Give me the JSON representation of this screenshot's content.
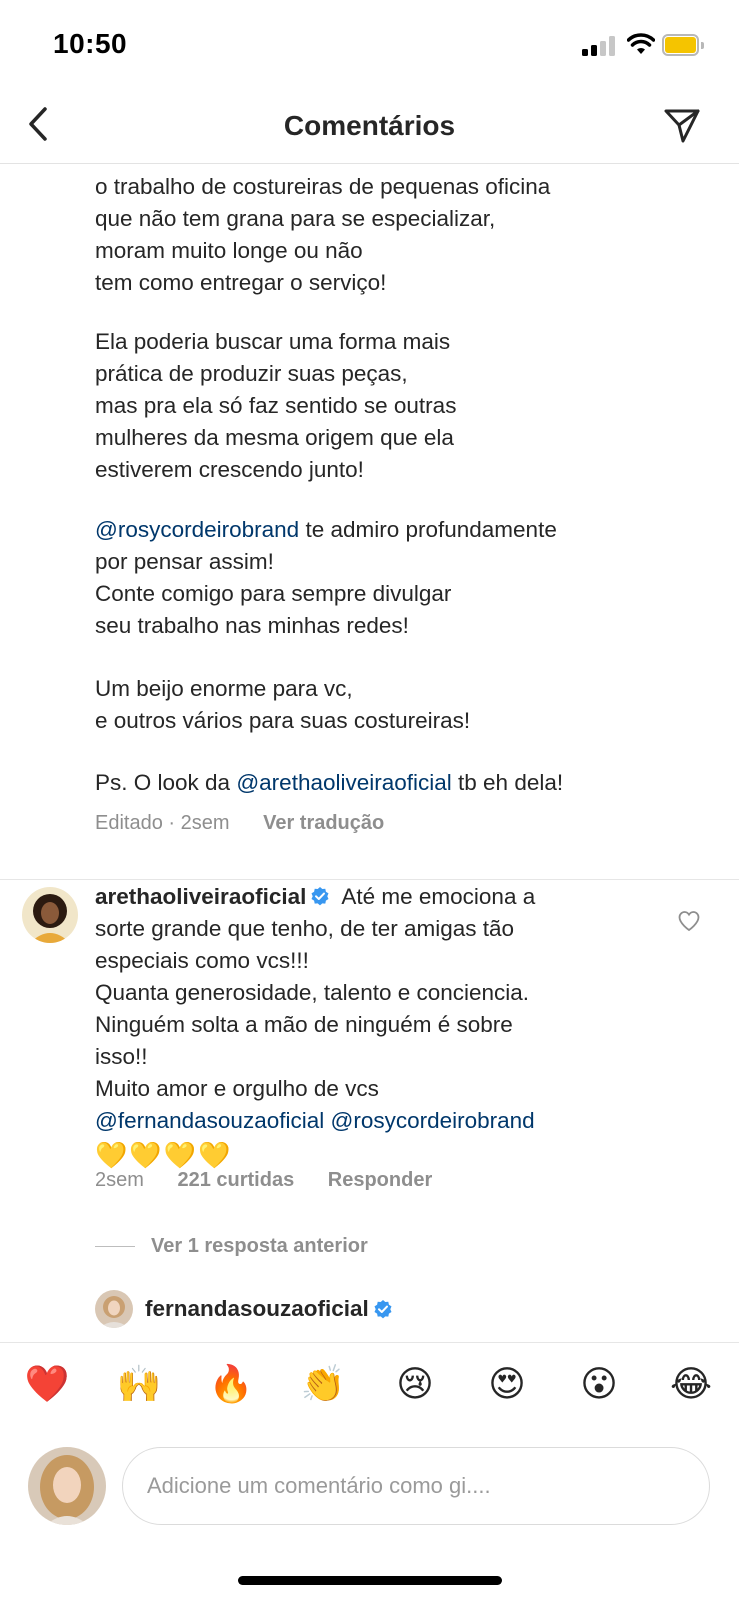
{
  "status_bar": {
    "time": "10:50"
  },
  "header": {
    "title": "Comentários"
  },
  "caption": {
    "lines_a": [
      "o trabalho de costureiras de pequenas oficina",
      "que não tem grana para se especializar,",
      "moram muito longe ou não",
      "tem como entregar o serviço!"
    ],
    "lines_b": [
      "Ela poderia buscar uma forma mais",
      "prática de produzir suas peças,",
      "mas pra ela só faz sentido se outras",
      "mulheres da mesma origem que ela",
      "estiverem crescendo junto!"
    ],
    "mention_1": "@rosycordeirobrand",
    "line_c1_rest": " te admiro profundamente",
    "lines_c": [
      "por pensar assim!",
      "Conte comigo para sempre divulgar",
      "seu trabalho nas minhas redes!"
    ],
    "lines_d": [
      "Um beijo enorme para vc,",
      "e outros vários para suas costureiras!"
    ],
    "ps_prefix": "Ps. O look da ",
    "mention_2": "@arethaoliveiraoficial",
    "ps_suffix": " tb eh dela!",
    "meta_time": "Editado · 2sem",
    "see_translation": "Ver tradução"
  },
  "comment": {
    "username": "arethaoliveiraoficial",
    "first_line_text": " Até me emociona a",
    "lines": [
      "sorte grande que tenho, de ter amigas tão",
      "especiais como vcs!!!",
      "Quanta generosidade, talento e conciencia.",
      "Ninguém solta a mão de ninguém é sobre",
      "isso!!",
      "Muito amor e orgulho de vcs"
    ],
    "mention_a": "@fernandasouzaoficial",
    "mention_b": "@rosycordeirobrand",
    "hearts": "💛💛💛💛",
    "time": "2sem",
    "likes": "221 curtidas",
    "reply": "Responder",
    "view_replies": "Ver 1 resposta anterior"
  },
  "reply_preview": {
    "username": "fernandasouzaoficial"
  },
  "emojis": [
    "❤️",
    "🙌",
    "🔥",
    "👏",
    "😢",
    "😍",
    "😮",
    "😂"
  ],
  "composer": {
    "placeholder": "Adicione um comentário como gi...."
  },
  "colors": {
    "mention": "#00376b",
    "verified": "#3897f0",
    "muted": "#8e8e8e",
    "battery": "#f5c400"
  }
}
